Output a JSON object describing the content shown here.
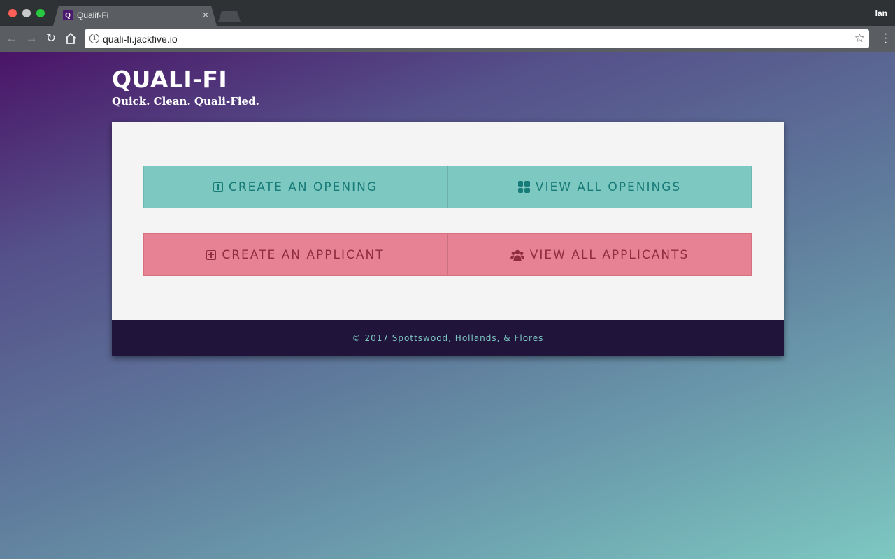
{
  "browser": {
    "tab_title": "Qualif-Fi",
    "tab_favicon": "Q",
    "tab_close": "×",
    "profile_name": "Ian",
    "url": "quali-fi.jackfive.io",
    "icons": {
      "back": "back-arrow-icon",
      "forward": "forward-arrow-icon",
      "reload": "reload-icon",
      "home": "home-icon",
      "info": "info-icon",
      "bookmark": "star-icon",
      "menu": "kebab-menu-icon"
    }
  },
  "header": {
    "title": "QUALI-FI",
    "tagline": "Quick. Clean. Quali-Fied."
  },
  "actions": {
    "create_opening": "CREATE AN OPENING",
    "view_openings": "VIEW ALL OPENINGS",
    "create_applicant": "CREATE AN APPLICANT",
    "view_applicants": "VIEW ALL APPLICANTS"
  },
  "colors": {
    "teal": "#7ec8c2",
    "teal_text": "#177b78",
    "pink": "#e68293",
    "pink_text": "#8e2d3e",
    "footer_bg": "#20143b"
  },
  "footer": {
    "copyright": "© 2017 Spottswood, Hollands, & Flores"
  }
}
